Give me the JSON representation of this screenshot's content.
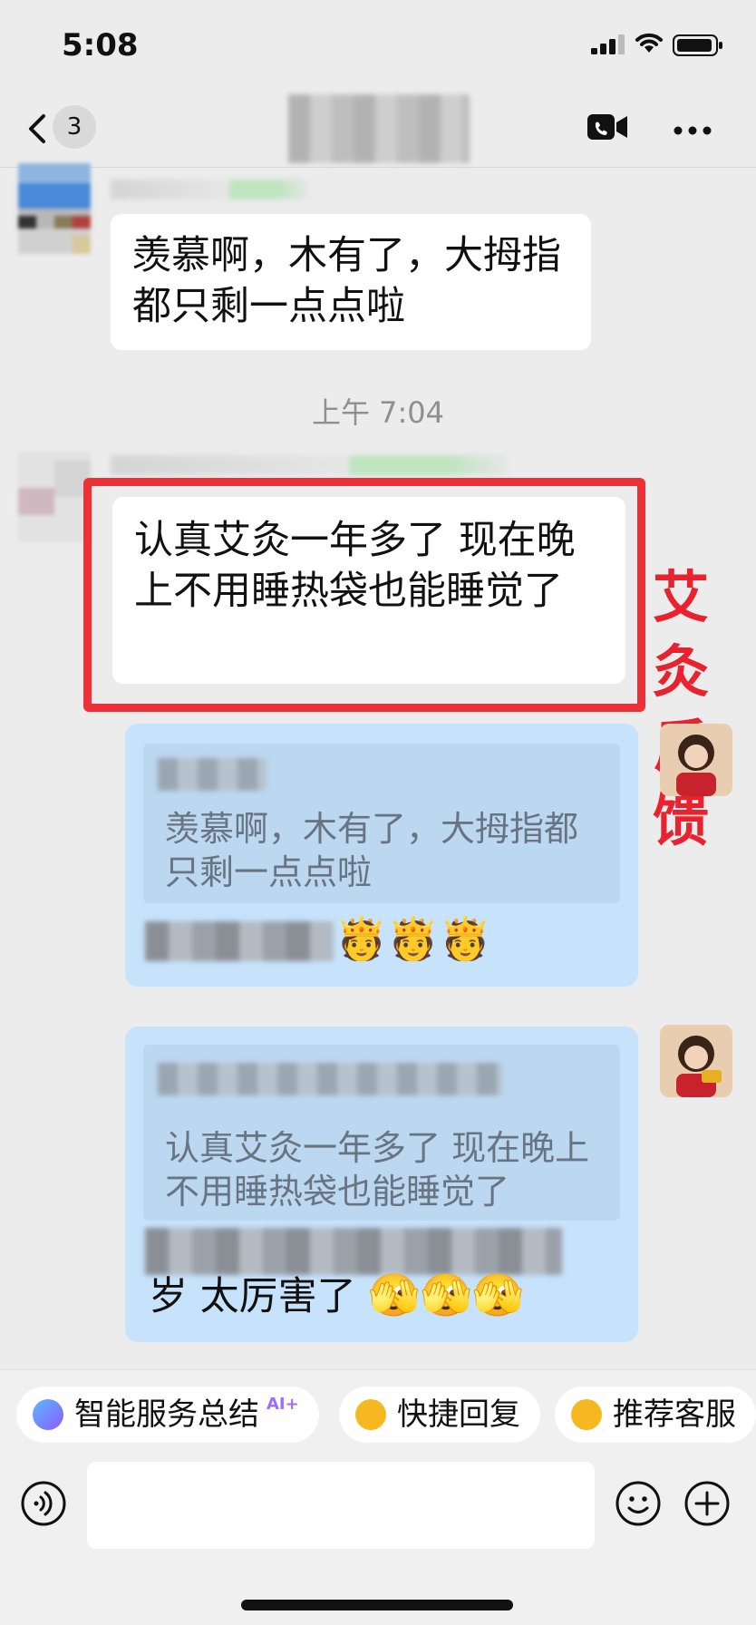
{
  "status_bar": {
    "time": "5:08"
  },
  "header": {
    "back_count": "3"
  },
  "messages": {
    "msg1_text": "羡慕啊，木有了，大拇指都只剩一点点啦",
    "time_separator": "上午 7:04",
    "msg2_text": "认真艾灸一年多了 现在晚上不用睡热袋也能睡觉了",
    "reply1": {
      "quote_text": "羡慕啊，木有了，大拇指都只剩一点点啦",
      "emojis": "🫅🫅🫅"
    },
    "reply2": {
      "quote_text": "认真艾灸一年多了 现在晚上不用睡热袋也能睡觉了",
      "text": "岁 太厉害了",
      "emojis": "🫣🫣🫣"
    }
  },
  "annotation": {
    "chars": [
      "艾",
      "灸",
      "反",
      "馈"
    ]
  },
  "quick_actions": {
    "summary": "智能服务总结",
    "summary_tag": "AI+",
    "quick_reply": "快捷回复",
    "recommend": "推荐客服"
  },
  "colors": {
    "highlight_border": "#ee3037",
    "annotation_text": "#e8232f",
    "right_bubble": "#c7e3fb"
  },
  "icons": [
    "back-chevron-icon",
    "video-call-icon",
    "more-dots-icon",
    "voice-icon",
    "emoji-icon",
    "plus-icon"
  ]
}
